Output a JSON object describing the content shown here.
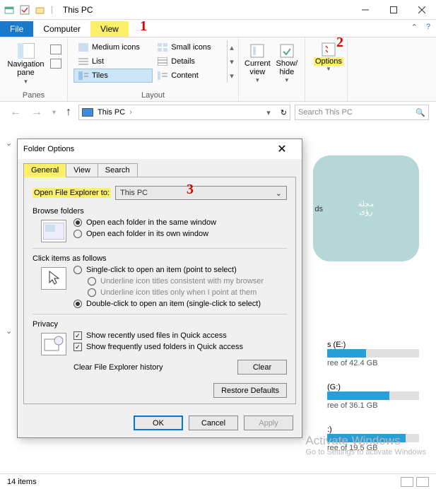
{
  "titlebar": {
    "title": "This PC"
  },
  "tabs": {
    "file": "File",
    "computer": "Computer",
    "view": "View"
  },
  "ribbon": {
    "panes_group": "Panes",
    "layout_group": "Layout",
    "nav_pane": "Navigation\npane",
    "layouts": {
      "medium": "Medium icons",
      "small": "Small icons",
      "list": "List",
      "details": "Details",
      "tiles": "Tiles",
      "content": "Content"
    },
    "current_view": "Current\nview",
    "show_hide": "Show/\nhide",
    "options": "Options"
  },
  "address": {
    "path": "This PC",
    "search_placeholder": "Search This PC"
  },
  "dialog": {
    "title": "Folder Options",
    "tabs": {
      "general": "General",
      "view": "View",
      "search": "Search"
    },
    "open_label": "Open File Explorer to:",
    "open_value": "This PC",
    "browse_title": "Browse folders",
    "browse_same": "Open each folder in the same window",
    "browse_own": "Open each folder in its own window",
    "click_title": "Click items as follows",
    "click_single": "Single-click to open an item (point to select)",
    "click_ul_browser": "Underline icon titles consistent with my browser",
    "click_ul_point": "Underline icon titles only when I point at them",
    "click_double": "Double-click to open an item (single-click to select)",
    "privacy_title": "Privacy",
    "privacy_recent": "Show recently used files in Quick access",
    "privacy_freq": "Show frequently used folders in Quick access",
    "clear_label": "Clear File Explorer history",
    "clear_btn": "Clear",
    "restore": "Restore Defaults",
    "ok": "OK",
    "cancel": "Cancel",
    "apply": "Apply"
  },
  "drives": [
    {
      "label": "s (E:)",
      "free": "ree of 42.4 GB",
      "fill": 42
    },
    {
      "label": "(G:)",
      "free": "ree of 36.1 GB",
      "fill": 68
    },
    {
      "label": ":)",
      "free": "ree of 19.5 GB",
      "fill": 85
    }
  ],
  "status": {
    "items": "14 items"
  },
  "activate": {
    "t1": "Activate Windows",
    "t2": "Go to Settings to activate Windows"
  },
  "annotations": {
    "a1": "1",
    "a2": "2",
    "a3": "3"
  },
  "watermark": "مجلة\nرؤى"
}
